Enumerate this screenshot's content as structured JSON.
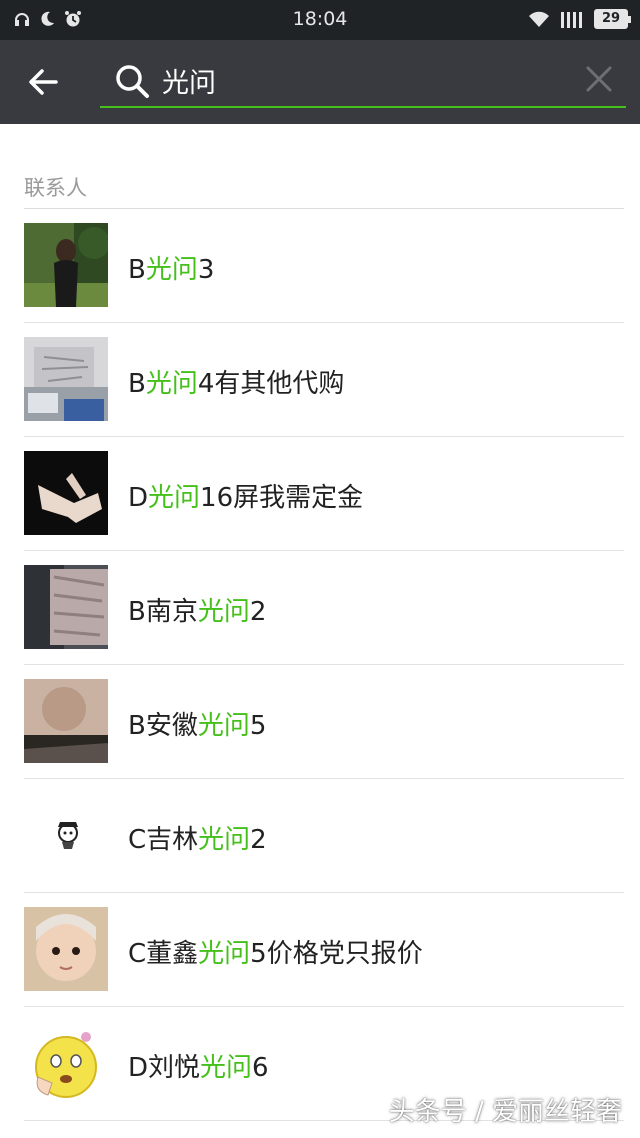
{
  "status_bar": {
    "time": "18:04",
    "battery": "29",
    "icons": [
      "headset-icon",
      "moon-icon",
      "alarm-icon",
      "wifi-icon",
      "signal-icon",
      "battery-icon"
    ]
  },
  "search": {
    "query": "光问",
    "accent": "#45c01a"
  },
  "section": {
    "title": "联系人"
  },
  "contacts": [
    {
      "pre": "B",
      "hl": "光问",
      "post": "3"
    },
    {
      "pre": "B",
      "hl": "光问",
      "post": "4有其他代购"
    },
    {
      "pre": "D",
      "hl": "光问",
      "post": "16屏我需定金"
    },
    {
      "pre": "B南京",
      "hl": "光问",
      "post": "2"
    },
    {
      "pre": "B安徽",
      "hl": "光问",
      "post": "5"
    },
    {
      "pre": "C吉林",
      "hl": "光问",
      "post": "2"
    },
    {
      "pre": "C董鑫",
      "hl": "光问",
      "post": "5价格党只报价"
    },
    {
      "pre": "D刘悦",
      "hl": "光问",
      "post": "6"
    }
  ],
  "watermark": "头条号 / 爱丽丝轻奢"
}
